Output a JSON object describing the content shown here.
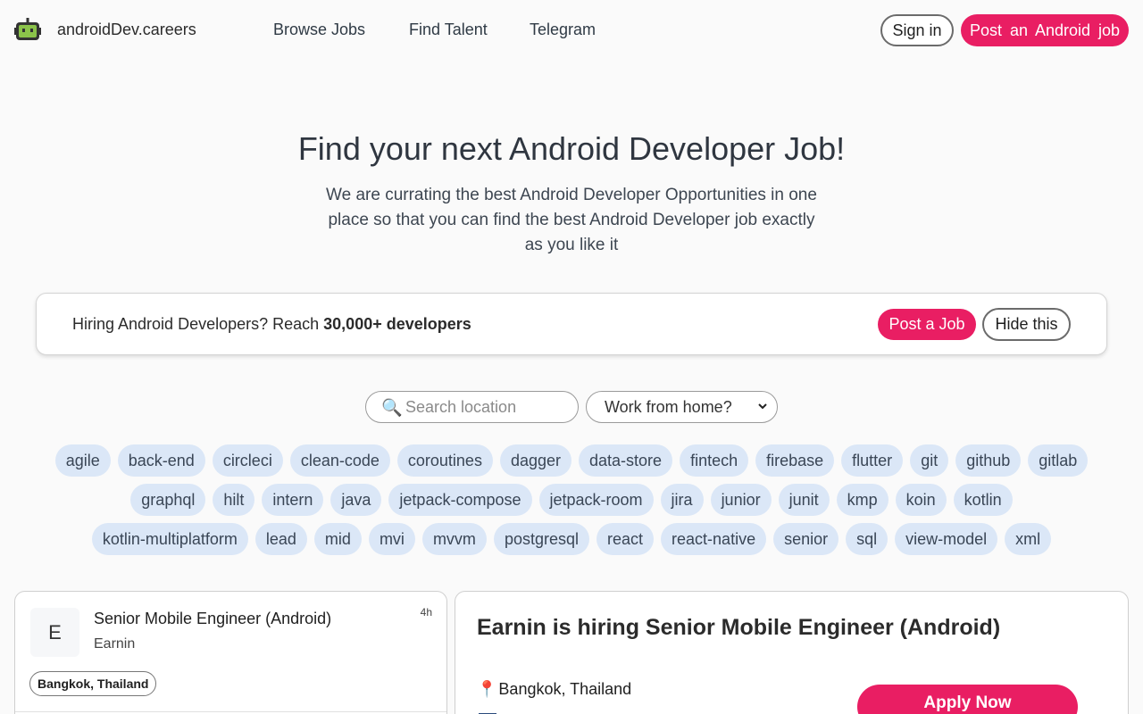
{
  "header": {
    "logo_text": "androidDev.careers",
    "nav": [
      "Browse Jobs",
      "Find Talent",
      "Telegram"
    ],
    "sign_in": "Sign in",
    "post_android_job": "Post an Android job"
  },
  "hero": {
    "title": "Find your next Android Developer Job!",
    "subtitle": "We are currating the best Android Developer Opportunities in one place so that you can find the best Android Developer job exactly as you like it"
  },
  "banner": {
    "text_prefix": "Hiring Android Developers? Reach ",
    "text_bold": "30,000+ developers",
    "post_job": "Post a Job",
    "hide": "Hide this"
  },
  "filters": {
    "search_placeholder": "Search location",
    "wfh_selected": "Work from home?"
  },
  "tags": [
    [
      "agile",
      "back-end",
      "circleci",
      "clean-code",
      "coroutines",
      "dagger",
      "data-store",
      "fintech",
      "firebase",
      "flutter",
      "git",
      "github",
      "gitlab"
    ],
    [
      "graphql",
      "hilt",
      "intern",
      "java",
      "jetpack-compose",
      "jetpack-room",
      "jira",
      "junior",
      "junit",
      "kmp",
      "koin",
      "kotlin"
    ],
    [
      "kotlin-multiplatform",
      "lead",
      "mid",
      "mvi",
      "mvvm",
      "postgresql",
      "react",
      "react-native",
      "senior",
      "sql",
      "view-model",
      "xml"
    ]
  ],
  "job_card": {
    "avatar_letter": "E",
    "title": "Senior Mobile Engineer (Android)",
    "company": "Earnin",
    "age": "4h",
    "location": "Bangkok, Thailand"
  },
  "detail": {
    "title": "Earnin is hiring Senior Mobile Engineer (Android)",
    "location": "Bangkok, Thailand",
    "apply": "Apply Now"
  },
  "colors": {
    "accent": "#e91e63",
    "tag_bg": "#dbe7f7",
    "logo_green": "#8bc34a"
  }
}
